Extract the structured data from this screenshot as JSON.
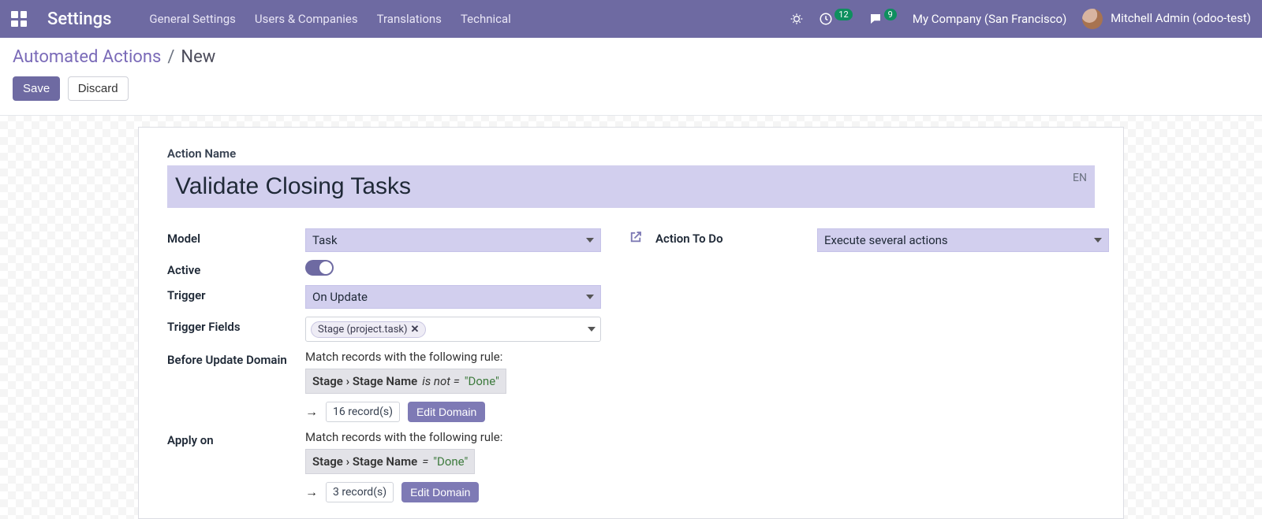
{
  "navbar": {
    "app_title": "Settings",
    "menu": [
      "General Settings",
      "Users & Companies",
      "Translations",
      "Technical"
    ],
    "clock_badge": "12",
    "chat_badge": "9",
    "company": "My Company (San Francisco)",
    "user": "Mitchell Admin (odoo-test)"
  },
  "breadcrumb": {
    "root": "Automated Actions",
    "sep": "/",
    "current": "New"
  },
  "buttons": {
    "save": "Save",
    "discard": "Discard",
    "edit_domain": "Edit Domain"
  },
  "form": {
    "action_name_label": "Action Name",
    "action_name_value": "Validate Closing Tasks",
    "lang_badge": "EN",
    "model_label": "Model",
    "model_value": "Task",
    "action_to_do_label": "Action To Do",
    "action_to_do_value": "Execute several actions",
    "active_label": "Active",
    "trigger_label": "Trigger",
    "trigger_value": "On Update",
    "trigger_fields_label": "Trigger Fields",
    "trigger_fields_tag": "Stage (project.task)",
    "before_update_label": "Before Update Domain",
    "match_rule_text": "Match records with the following rule:",
    "before_domain": {
      "path": "Stage › Stage Name",
      "op": "is not =",
      "val": "\"Done\"",
      "records": "16 record(s)"
    },
    "apply_on_label": "Apply on",
    "apply_domain": {
      "path": "Stage › Stage Name",
      "op": "=",
      "val": "\"Done\"",
      "records": "3 record(s)"
    }
  }
}
